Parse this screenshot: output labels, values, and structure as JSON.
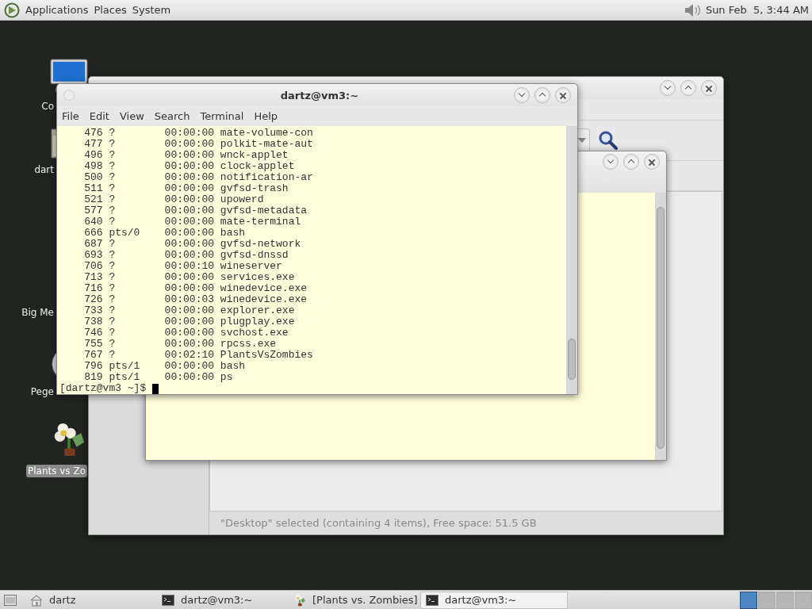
{
  "top_panel": {
    "menus": [
      "Applications",
      "Places",
      "System"
    ],
    "clock": "Sun Feb  5, 3:44 AM"
  },
  "desktop_icons": [
    {
      "label": "Co",
      "kind": "computer",
      "selected": false
    },
    {
      "label": "dart",
      "kind": "home",
      "selected": false
    },
    {
      "label": "Big Me",
      "selected": false
    },
    {
      "label": "Pege",
      "kind": "disc",
      "selected": false
    },
    {
      "label": "Plants vs Zo",
      "kind": "flower",
      "selected": true
    }
  ],
  "file_manager": {
    "status": "\"Desktop\" selected (containing 4 items), Free space: 51.5 GB"
  },
  "terminal": {
    "title": "dartz@vm3:~",
    "menus": [
      "File",
      "Edit",
      "View",
      "Search",
      "Terminal",
      "Help"
    ],
    "lines": [
      "    476 ?        00:00:00 mate-volume-con",
      "    477 ?        00:00:00 polkit-mate-aut",
      "    496 ?        00:00:00 wnck-applet",
      "    498 ?        00:00:00 clock-applet",
      "    500 ?        00:00:00 notification-ar",
      "    511 ?        00:00:00 gvfsd-trash",
      "    521 ?        00:00:00 upowerd",
      "    577 ?        00:00:00 gvfsd-metadata",
      "    640 ?        00:00:00 mate-terminal",
      "    666 pts/0    00:00:00 bash",
      "    687 ?        00:00:00 gvfsd-network",
      "    693 ?        00:00:00 gvfsd-dnssd",
      "    706 ?        00:00:10 wineserver",
      "    713 ?        00:00:00 services.exe",
      "    716 ?        00:00:00 winedevice.exe",
      "    726 ?        00:00:03 winedevice.exe",
      "    733 ?        00:00:00 explorer.exe",
      "    738 ?        00:00:00 plugplay.exe",
      "    746 ?        00:00:00 svchost.exe",
      "    755 ?        00:00:00 rpcss.exe",
      "    767 ?        00:02:10 PlantsVsZombies",
      "    796 pts/1    00:00:00 bash",
      "    819 pts/1    00:00:00 ps"
    ],
    "prompt": "[dartz@vm3 ~]$ "
  },
  "taskbar": {
    "items": [
      {
        "label": "dartz",
        "kind": "home",
        "selected": false
      },
      {
        "label": "dartz@vm3:~",
        "kind": "terminal",
        "selected": false
      },
      {
        "label": "[Plants vs. Zombies]",
        "kind": "flower",
        "selected": false
      },
      {
        "label": "dartz@vm3:~",
        "kind": "terminal",
        "selected": true
      }
    ],
    "workspaces": [
      {
        "selected": true
      },
      {
        "selected": false
      },
      {
        "selected": false
      },
      {
        "selected": false
      }
    ]
  }
}
